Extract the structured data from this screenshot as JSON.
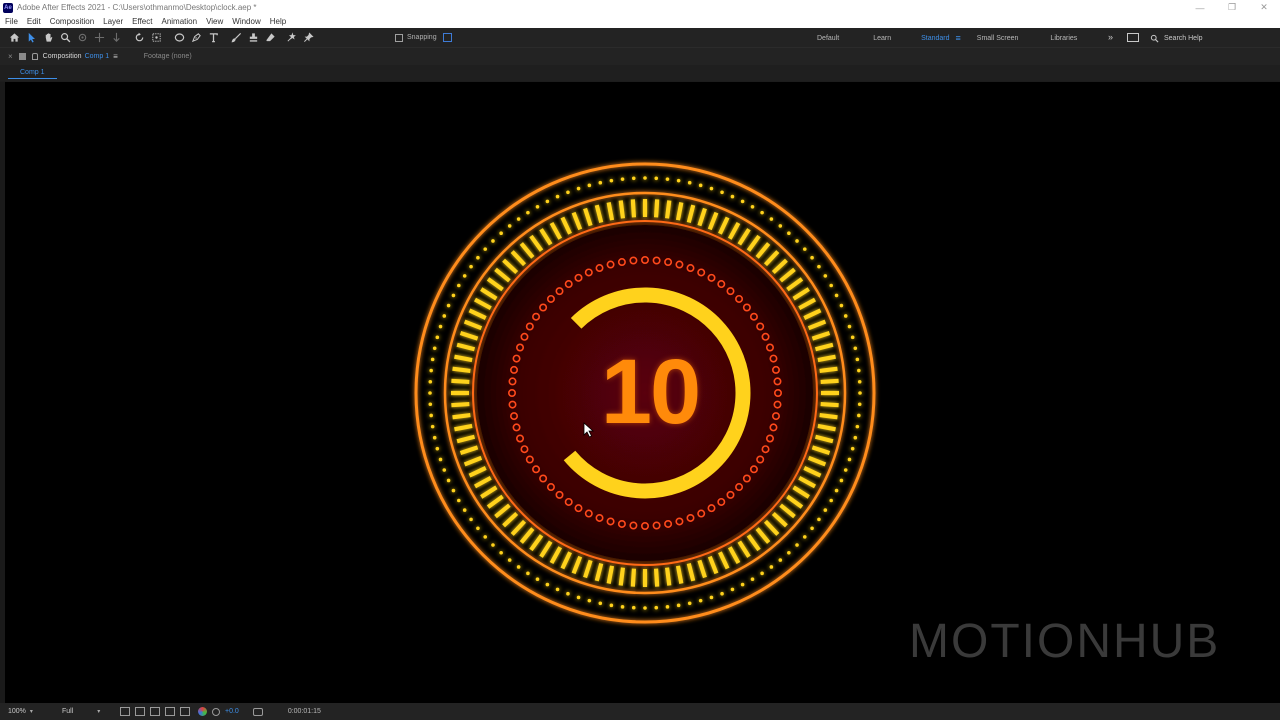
{
  "window": {
    "title": "Adobe After Effects 2021 - C:\\Users\\othmanmo\\Desktop\\clock.aep *",
    "app_icon": "Ae",
    "controls": [
      "—",
      "❐",
      "✕"
    ]
  },
  "menu": {
    "items": [
      "File",
      "Edit",
      "Composition",
      "Layer",
      "Effect",
      "Animation",
      "View",
      "Window",
      "Help"
    ]
  },
  "toolbar": {
    "snapping_label": "Snapping",
    "workspaces": [
      "Default",
      "Learn",
      "Standard",
      "Small Screen",
      "Libraries"
    ],
    "active_workspace": "Standard",
    "more_glyph": "»",
    "search_label": "Search Help"
  },
  "panel": {
    "close_glyph": "×",
    "composition_label": "Composition",
    "composition_name": "Comp 1",
    "menu_glyph": "≡",
    "footage_label": "Footage (none)",
    "comp_tab": "Comp 1"
  },
  "viewer": {
    "timer_text": "10",
    "watermark": "MOTIONHUB",
    "colors": {
      "background": "#000000",
      "ring_orange": "#ff8c1a",
      "ring_yellow": "#ffd21a",
      "dot_red": "#ff4a1a",
      "number_orange": "#ff8a0a",
      "inner_fill": "#5a0608"
    }
  },
  "footer": {
    "zoom": "100%",
    "resolution": "Full",
    "exposure": "+0.0",
    "timecode": "0:00:01:15"
  }
}
